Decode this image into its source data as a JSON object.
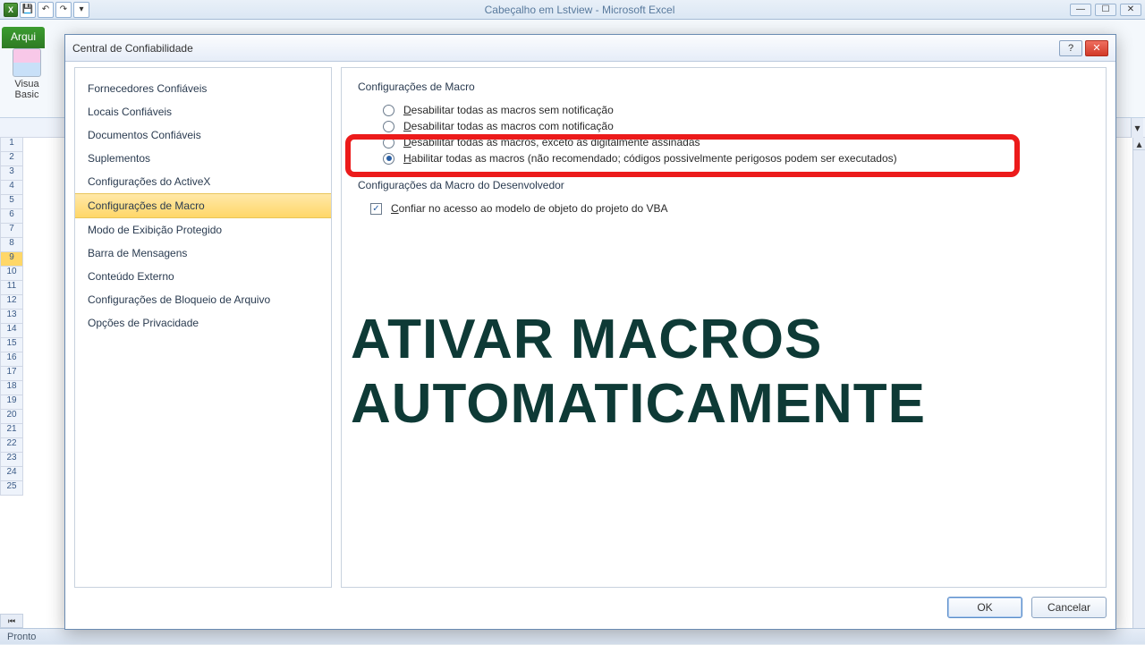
{
  "app_title": "Cabeçalho em Lstview  -  Microsoft Excel",
  "ribbon": {
    "file_tab": "Arqui",
    "vb_line1": "Visua",
    "vb_line2": "Basic"
  },
  "rows": [
    "1",
    "2",
    "3",
    "4",
    "5",
    "6",
    "7",
    "8",
    "9",
    "10",
    "11",
    "12",
    "13",
    "14",
    "15",
    "16",
    "17",
    "18",
    "19",
    "20",
    "21",
    "22",
    "23",
    "24",
    "25"
  ],
  "selected_row": "9",
  "statusbar": "Pronto",
  "dialog": {
    "title": "Central de Confiabilidade",
    "nav": [
      "Fornecedores Confiáveis",
      "Locais Confiáveis",
      "Documentos Confiáveis",
      "Suplementos",
      "Configurações do ActiveX",
      "Configurações de Macro",
      "Modo de Exibição Protegido",
      "Barra de Mensagens",
      "Conteúdo Externo",
      "Configurações de Bloqueio de Arquivo",
      "Opções de Privacidade"
    ],
    "nav_selected": "Configurações de Macro",
    "section1_title": "Configurações de Macro",
    "radios": [
      {
        "u": "D",
        "rest": "esabilitar todas as macros sem notificação",
        "checked": false
      },
      {
        "u": "D",
        "rest": "esabilitar todas as macros com notificação",
        "checked": false
      },
      {
        "u": "D",
        "rest": "esabilitar todas as macros, exceto as digitalmente assinadas",
        "checked": false
      },
      {
        "u": "H",
        "rest": "abilitar todas as macros (não recomendado; códigos possivelmente perigosos podem ser executados)",
        "checked": true
      }
    ],
    "section2_title": "Configurações da Macro do Desenvolvedor",
    "checkbox": {
      "u": "C",
      "rest": "onfiar no acesso ao modelo de objeto do projeto do VBA",
      "checked": true
    },
    "ok": "OK",
    "cancel": "Cancelar"
  },
  "overlay": {
    "line1": "ATIVAR MACROS",
    "line2": "AUTOMATICAMENTE"
  }
}
